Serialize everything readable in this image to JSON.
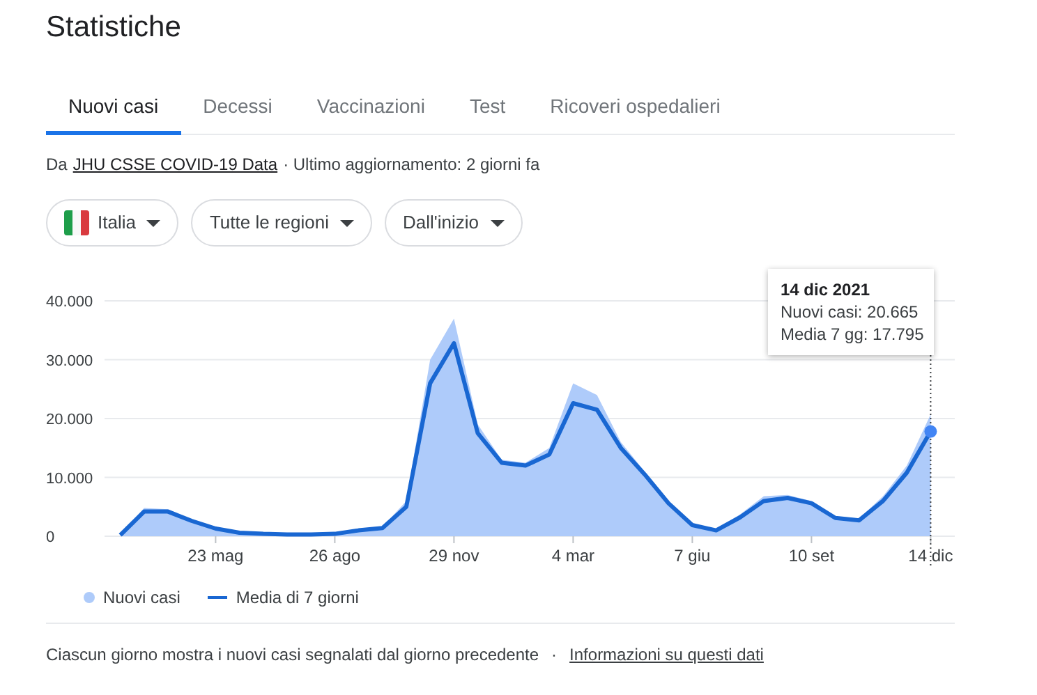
{
  "title": "Statistiche",
  "tabs": [
    {
      "label": "Nuovi casi",
      "selected": true
    },
    {
      "label": "Decessi",
      "selected": false
    },
    {
      "label": "Vaccinazioni",
      "selected": false
    },
    {
      "label": "Test",
      "selected": false
    },
    {
      "label": "Ricoveri ospedalieri",
      "selected": false
    }
  ],
  "source": {
    "prefix": "Da",
    "link": "JHU CSSE COVID-19 Data",
    "suffix": "· Ultimo aggiornamento: 2 giorni fa"
  },
  "filters": [
    {
      "label": "Italia",
      "flag": true
    },
    {
      "label": "Tutte le regioni",
      "flag": false
    },
    {
      "label": "Dall'inizio",
      "flag": false
    }
  ],
  "chart": {
    "tooltip": {
      "date": "14 dic 2021",
      "lines": [
        "Nuovi casi: 20.665",
        "Media 7 gg: 17.795"
      ]
    },
    "chart_data": {
      "type": "area",
      "categories": [
        null,
        null,
        null,
        null,
        "23 mag",
        null,
        null,
        null,
        null,
        "26 ago",
        null,
        null,
        null,
        null,
        "29 nov",
        null,
        null,
        null,
        null,
        "4 mar",
        null,
        null,
        null,
        null,
        "7 giu",
        null,
        null,
        null,
        null,
        "10 set",
        null,
        null,
        null,
        null,
        "14 dic"
      ],
      "series": [
        {
          "name": "Nuovi casi",
          "color": "#aecbfa",
          "type": "area",
          "values": [
            300,
            4800,
            4600,
            2800,
            1400,
            600,
            400,
            300,
            300,
            500,
            1200,
            1600,
            6000,
            30000,
            37000,
            19000,
            13000,
            12500,
            15000,
            26000,
            24000,
            16000,
            11000,
            6000,
            2200,
            1200,
            3700,
            6800,
            7000,
            6000,
            3400,
            3000,
            6800,
            12000,
            20700
          ]
        },
        {
          "name": "Media di 7 giorni",
          "color": "#1967d2",
          "type": "line",
          "values": [
            200,
            4200,
            4200,
            2600,
            1300,
            600,
            400,
            300,
            300,
            400,
            1000,
            1400,
            5000,
            26000,
            32800,
            17500,
            12500,
            12000,
            13900,
            22600,
            21500,
            15000,
            10500,
            5600,
            1900,
            1000,
            3200,
            6000,
            6500,
            5600,
            3100,
            2700,
            6000,
            10800,
            17800
          ]
        }
      ],
      "ylim": [
        0,
        40000
      ],
      "grid": true,
      "yticks": [
        {
          "value": 0,
          "label": "0"
        },
        {
          "value": 10000,
          "label": "10.000"
        },
        {
          "value": 20000,
          "label": "20.000"
        },
        {
          "value": 30000,
          "label": "30.000"
        },
        {
          "value": 40000,
          "label": "40.000"
        }
      ]
    }
  },
  "footer": {
    "note": "Ciascun giorno mostra i nuovi casi segnalati dal giorno precedente",
    "separator": "·",
    "link": "Informazioni su questi dati"
  }
}
